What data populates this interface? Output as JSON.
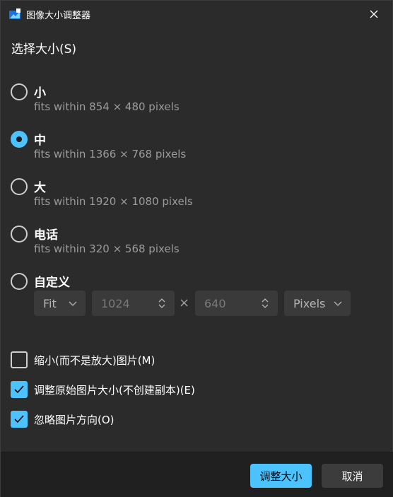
{
  "window": {
    "title": "图像大小调整器"
  },
  "section_title": "选择大小(S)",
  "options": [
    {
      "label": "小",
      "desc": "fits within 854 × 480 pixels",
      "selected": false
    },
    {
      "label": "中",
      "desc": "fits within 1366 × 768 pixels",
      "selected": true
    },
    {
      "label": "大",
      "desc": "fits within 1920 × 1080 pixels",
      "selected": false
    },
    {
      "label": "电话",
      "desc": "fits within 320 × 568 pixels",
      "selected": false
    },
    {
      "label": "自定义",
      "selected": false
    }
  ],
  "custom": {
    "fit_mode": "Fit",
    "width": "1024",
    "times": "×",
    "height": "640",
    "unit": "Pixels"
  },
  "checkboxes": [
    {
      "label": "缩小(而不是放大)图片(M)",
      "checked": false
    },
    {
      "label": "调整原始图片大小(不创建副本)(E)",
      "checked": true
    },
    {
      "label": "忽略图片方向(O)",
      "checked": true
    }
  ],
  "buttons": {
    "primary": "调整大小",
    "secondary": "取消"
  },
  "colors": {
    "accent": "#4cc2ff",
    "background": "#2b2b2b",
    "footer": "#202020"
  }
}
